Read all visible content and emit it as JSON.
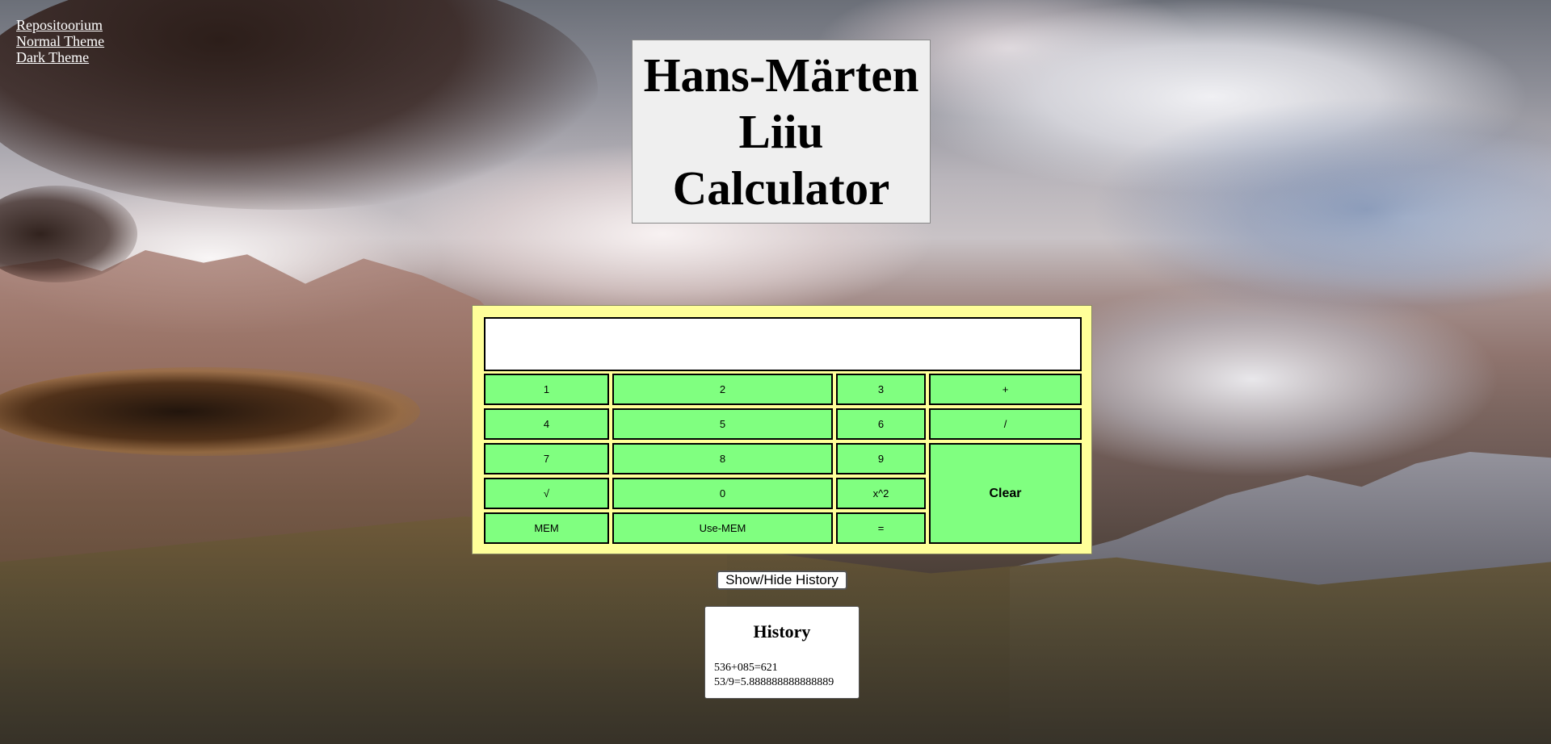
{
  "nav": {
    "links": [
      "Repositoorium",
      "Normal Theme",
      "Dark Theme"
    ]
  },
  "title": {
    "line1": "Hans-Märten",
    "line2": "Liiu",
    "line3": "Calculator"
  },
  "calculator": {
    "display_value": "",
    "keys": {
      "k1": "1",
      "k2": "2",
      "k3": "3",
      "plus": "+",
      "k4": "4",
      "k5": "5",
      "k6": "6",
      "divide": "/",
      "k7": "7",
      "k8": "8",
      "k9": "9",
      "clear": "Clear",
      "sqrt": "√",
      "k0": "0",
      "square": "x^2",
      "mem": "MEM",
      "use_mem": "Use-MEM",
      "equals": "="
    }
  },
  "history_toggle": "Show/Hide History",
  "history": {
    "heading": "History",
    "entries": [
      "536+085=621",
      "53/9=5.888888888888889"
    ]
  },
  "colors": {
    "calculator_background": "#ffff99",
    "key_background": "#80ff80",
    "title_background": "#efefef"
  }
}
